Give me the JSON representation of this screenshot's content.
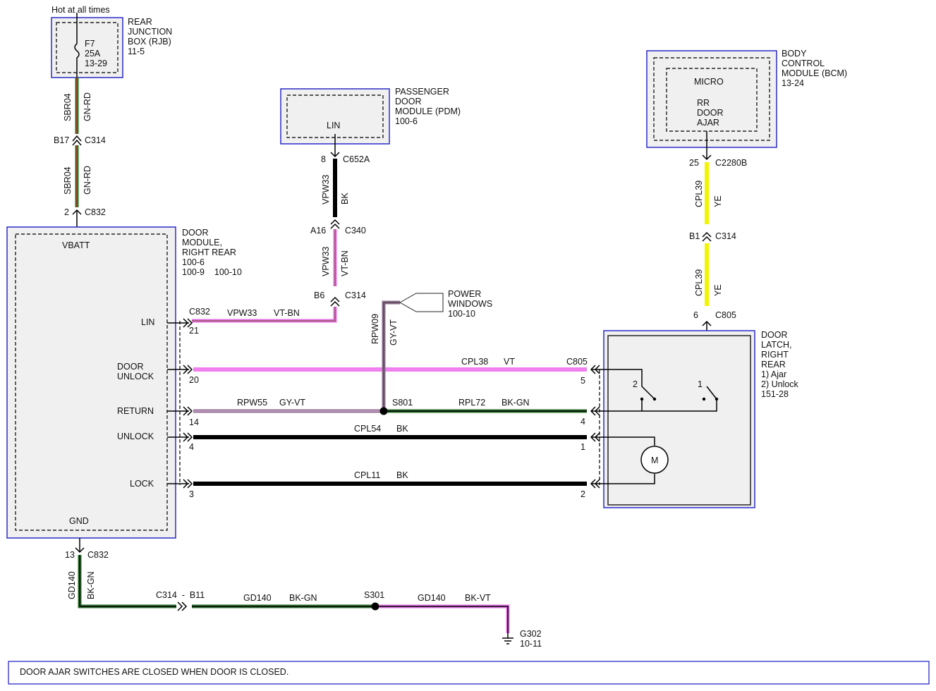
{
  "header": {
    "hot_label": "Hot at all times"
  },
  "rjb": {
    "name_lines": [
      "REAR",
      "JUNCTION",
      "BOX (RJB)",
      "11-5"
    ],
    "fuse": [
      "F7",
      "25A",
      "13-29"
    ]
  },
  "pdm": {
    "name_lines": [
      "PASSENGER",
      "DOOR",
      "MODULE (PDM)",
      "100-6"
    ],
    "pin": "LIN"
  },
  "bcm": {
    "name_lines": [
      "BODY",
      "CONTROL",
      "MODULE (BCM)",
      "13-24"
    ],
    "micro": "MICRO",
    "signal_lines": [
      "RR",
      "DOOR",
      "AJAR"
    ]
  },
  "door_module": {
    "name_lines": [
      "DOOR",
      "MODULE,",
      "RIGHT REAR",
      "100-6",
      "100-9    100-10"
    ],
    "vbatt": "VBATT",
    "gnd": "GND",
    "pins": {
      "lin": "LIN",
      "door_unlock_1": "DOOR",
      "door_unlock_2": "UNLOCK",
      "return": "RETURN",
      "unlock": "UNLOCK",
      "lock": "LOCK"
    }
  },
  "latch": {
    "name_lines": [
      "DOOR",
      "LATCH,",
      "RIGHT",
      "REAR",
      "1) Ajar",
      "2) Unlock",
      "151-28"
    ],
    "sw1": "1",
    "sw2": "2",
    "motor": "M"
  },
  "power_windows": {
    "name_lines": [
      "POWER",
      "WINDOWS",
      "100-10"
    ]
  },
  "wires": {
    "sbr04": "SBR04",
    "gn_rd": "GN-RD",
    "vpw33": "VPW33",
    "bk": "BK",
    "vt_bn": "VT-BN",
    "cpl39": "CPL39",
    "ye": "YE",
    "rpw09": "RPW09",
    "gy_vt": "GY-VT",
    "cpl38": "CPL38",
    "vt": "VT",
    "rpw55": "RPW55",
    "rpl72": "RPL72",
    "bk_gn": "BK-GN",
    "cpl54": "CPL54",
    "cpl11": "CPL11",
    "gd140": "GD140",
    "bk_vt": "BK-VT"
  },
  "connectors": {
    "c314": "C314",
    "c832": "C832",
    "c652a": "C652A",
    "c340": "C340",
    "c2280b": "C2280B",
    "c805": "C805",
    "s801": "S801",
    "s301": "S301",
    "c314_b11": "C314  -  B11"
  },
  "pins": {
    "b17": "B17",
    "p2": "2",
    "p8": "8",
    "a16": "A16",
    "b6": "B6",
    "p25": "25",
    "b1": "B1",
    "p6": "6",
    "p21": "21",
    "p20": "20",
    "p14": "14",
    "p4": "4",
    "p3": "3",
    "p5": "5",
    "p1": "1",
    "p13": "13"
  },
  "ground": {
    "name": "G302",
    "ref": "10-11"
  },
  "footer": {
    "note": "DOOR AJAR SWITCHES ARE CLOSED WHEN DOOR IS CLOSED."
  },
  "colors": {
    "gn_rd_a": "#1e7a1e",
    "gn_rd_b": "#c03030",
    "vt_bn": "#e070e0",
    "ye": "#f4f400",
    "vt": "#f080f0",
    "gy_vt": "#8f6f8f",
    "bk_gn": "#2f6f2f",
    "bk": "#000000",
    "border": "#2a2ac8"
  }
}
